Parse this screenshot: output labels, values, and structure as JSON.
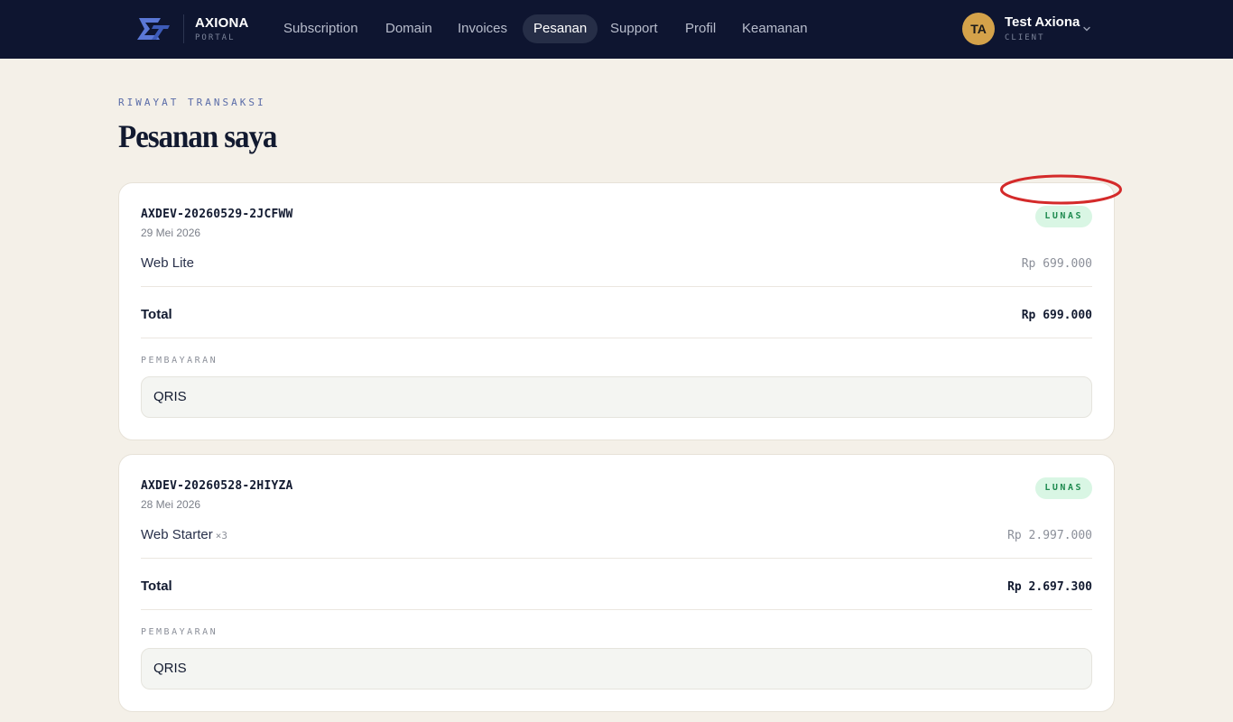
{
  "brand": {
    "name": "AXIONA",
    "sub": "PORTAL"
  },
  "nav": {
    "items": [
      {
        "label": "Subscription"
      },
      {
        "label": "Domain"
      },
      {
        "label": "Invoices"
      },
      {
        "label": "Pesanan",
        "active": true
      },
      {
        "label": "Support"
      },
      {
        "label": "Profil"
      },
      {
        "label": "Keamanan"
      }
    ]
  },
  "user": {
    "initials": "TA",
    "name": "Test Axiona",
    "role": "CLIENT"
  },
  "page": {
    "eyebrow": "RIWAYAT TRANSAKSI",
    "title": "Pesanan saya"
  },
  "orders": [
    {
      "id": "AXDEV-20260529-2JCFWW",
      "date": "29 Mei 2026",
      "status": "LUNAS",
      "item": {
        "name": "Web Lite",
        "qty": "",
        "price": "Rp 699.000"
      },
      "total_label": "Total",
      "total": "Rp 699.000",
      "payment_label": "PEMBAYARAN",
      "payment_method": "QRIS"
    },
    {
      "id": "AXDEV-20260528-2HIYZA",
      "date": "28 Mei 2026",
      "status": "LUNAS",
      "item": {
        "name": "Web Starter",
        "qty": "×3",
        "price": "Rp 2.997.000"
      },
      "total_label": "Total",
      "total": "Rp 2.697.300",
      "payment_label": "PEMBAYARAN",
      "payment_method": "QRIS"
    }
  ],
  "colors": {
    "nav_bg": "#0e1530",
    "page_bg": "#f4f0e8",
    "accent_eyebrow": "#5a6ca8",
    "badge_bg": "#d9f6e4",
    "badge_text": "#1e8a4f",
    "avatar_bg": "#d4a24a",
    "annotation": "#d42a2a"
  },
  "icons": {
    "logo": "axiona-logo-icon",
    "user_menu": "chevron-down-icon"
  }
}
